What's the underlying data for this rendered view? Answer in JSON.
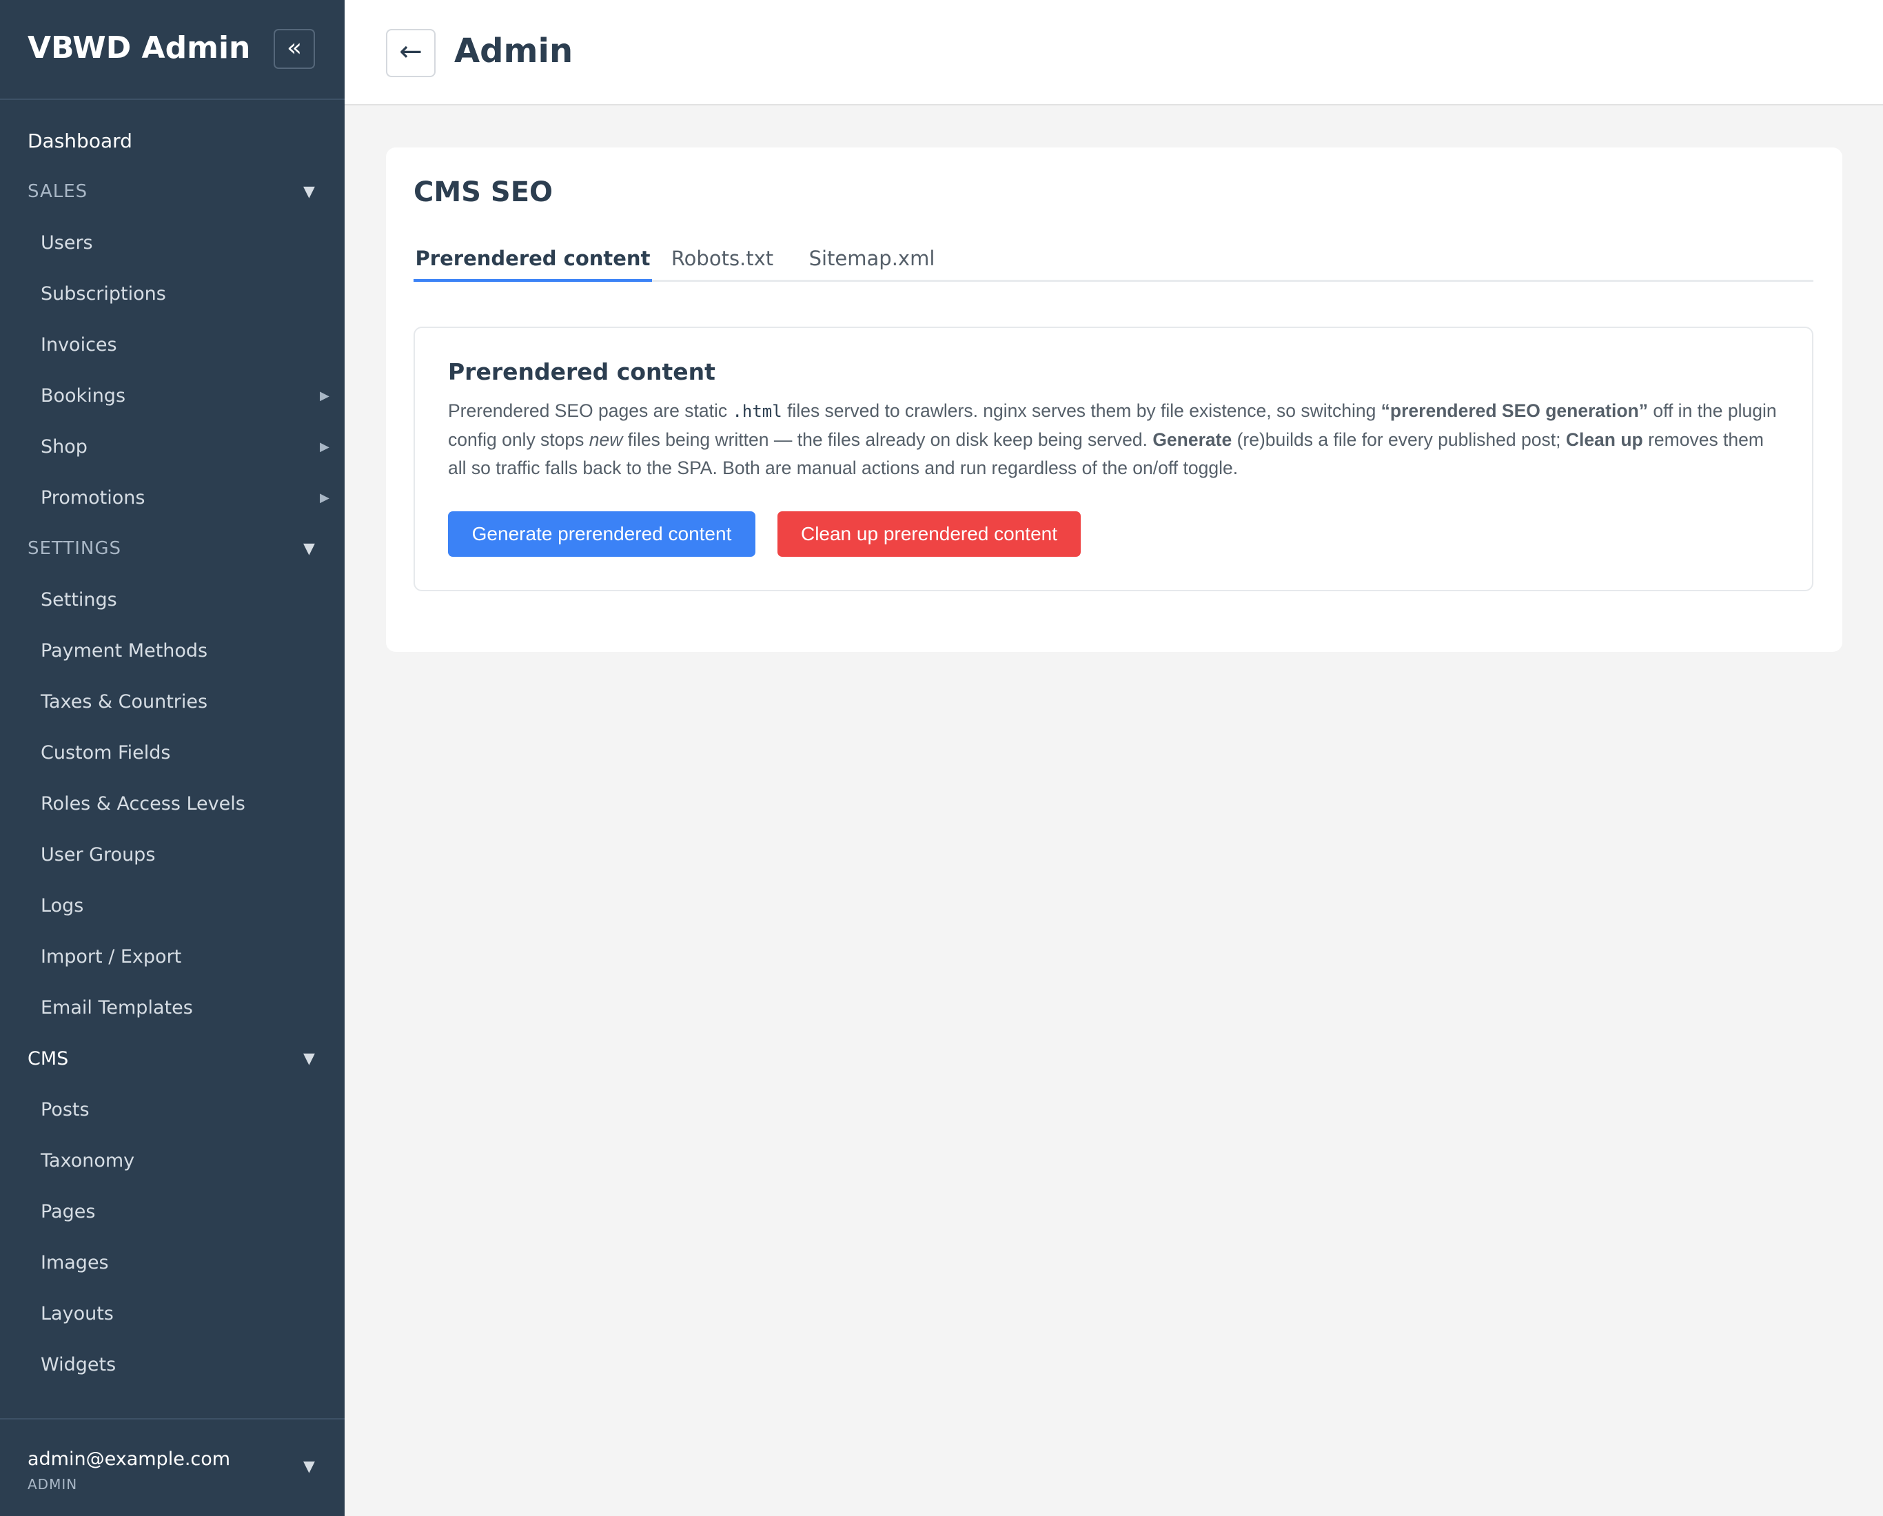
{
  "sidebar": {
    "brand": "VBWD Admin",
    "collapse_icon": "«",
    "dashboard": "Dashboard",
    "sales": {
      "label": "SALES",
      "items": [
        "Users",
        "Subscriptions",
        "Invoices",
        "Bookings",
        "Shop",
        "Promotions"
      ]
    },
    "settings": {
      "label": "SETTINGS",
      "items": [
        "Settings",
        "Payment Methods",
        "Taxes & Countries",
        "Custom Fields",
        "Roles & Access Levels",
        "User Groups",
        "Logs",
        "Import / Export",
        "Email Templates"
      ]
    },
    "cms": {
      "label": "CMS",
      "items": [
        "Posts",
        "Taxonomy",
        "Pages",
        "Images",
        "Layouts",
        "Widgets"
      ]
    },
    "user": {
      "email": "admin@example.com",
      "role": "ADMIN"
    }
  },
  "header": {
    "back_icon": "←",
    "title": "Admin"
  },
  "card": {
    "title": "CMS SEO",
    "tabs": [
      {
        "label": "Prerendered content",
        "active": true
      },
      {
        "label": "Robots.txt",
        "active": false
      },
      {
        "label": "Sitemap.xml",
        "active": false
      }
    ],
    "panel": {
      "title": "Prerendered content",
      "desc": {
        "p1": "Prerendered SEO pages are static ",
        "code": ".html",
        "p2": " files served to crawlers. nginx serves them by file existence, so switching ",
        "b1": "“prerendered SEO generation”",
        "p3": " off in the plugin config only stops ",
        "em": "new",
        "p4": " files being written — the files already on disk keep being served. ",
        "b2": "Generate",
        "p5": " (re)builds a file for every published post; ",
        "b3": "Clean up",
        "p6": " removes them all so traffic falls back to the SPA. Both are manual actions and run regardless of the on/off toggle."
      },
      "generate_label": "Generate prerendered content",
      "cleanup_label": "Clean up prerendered content"
    }
  },
  "colors": {
    "sidebar_bg": "#2c3e50",
    "primary": "#3b82f6",
    "danger": "#ef4444"
  }
}
